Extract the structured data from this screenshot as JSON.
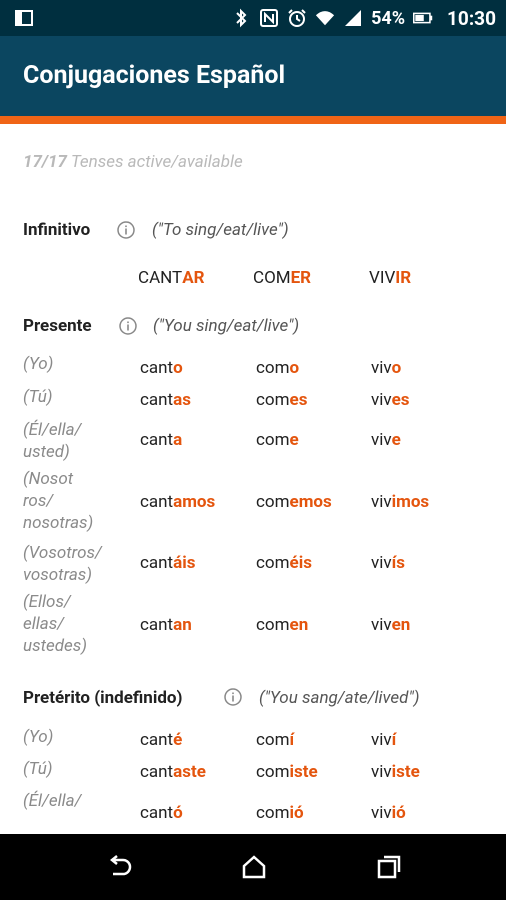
{
  "status_bar": {
    "battery_pct": "54%",
    "time": "10:30"
  },
  "app_bar": {
    "title": "Conjugaciones Español"
  },
  "summary": {
    "count": "17/17",
    "text": "Tenses active/available"
  },
  "infinitivo": {
    "title": "Infinitivo",
    "desc": "(\"To sing/eat/live\")",
    "verbs": [
      {
        "stem": "CANT",
        "end": "AR"
      },
      {
        "stem": "COM",
        "end": "ER"
      },
      {
        "stem": "VIV",
        "end": "IR"
      }
    ]
  },
  "presente": {
    "title": "Presente",
    "desc": "(\"You sing/eat/live\")",
    "rows": [
      {
        "pronoun": [
          "(Yo)"
        ],
        "forms": [
          {
            "stem": "cant",
            "end": "o"
          },
          {
            "stem": "com",
            "end": "o"
          },
          {
            "stem": "viv",
            "end": "o"
          }
        ]
      },
      {
        "pronoun": [
          "(Tú)"
        ],
        "forms": [
          {
            "stem": "cant",
            "end": "as"
          },
          {
            "stem": "com",
            "end": "es"
          },
          {
            "stem": "viv",
            "end": "es"
          }
        ]
      },
      {
        "pronoun": [
          "(Él/ella/",
          "usted)"
        ],
        "forms": [
          {
            "stem": "cant",
            "end": "a"
          },
          {
            "stem": "com",
            "end": "e"
          },
          {
            "stem": "viv",
            "end": "e"
          }
        ]
      },
      {
        "pronoun": [
          "(Nosot",
          "ros/",
          "nosotras)"
        ],
        "forms": [
          {
            "stem": "cant",
            "end": "amos"
          },
          {
            "stem": "com",
            "end": "emos"
          },
          {
            "stem": "viv",
            "end": "imos"
          }
        ]
      },
      {
        "pronoun": [
          "(Vosotros/",
          "vosotras)"
        ],
        "forms": [
          {
            "stem": "cant",
            "end": "áis"
          },
          {
            "stem": "com",
            "end": "éis"
          },
          {
            "stem": "viv",
            "end": "ís"
          }
        ]
      },
      {
        "pronoun": [
          "(Ellos/",
          "ellas/",
          "ustedes)"
        ],
        "forms": [
          {
            "stem": "cant",
            "end": "an"
          },
          {
            "stem": "com",
            "end": "en"
          },
          {
            "stem": "viv",
            "end": "en"
          }
        ]
      }
    ]
  },
  "preterito": {
    "title": "Pretérito (indefinido)",
    "desc": "(\"You sang/ate/lived\")",
    "rows": [
      {
        "pronoun": [
          "(Yo)"
        ],
        "forms": [
          {
            "stem": "cant",
            "end": "é"
          },
          {
            "stem": "com",
            "end": "í"
          },
          {
            "stem": "viv",
            "end": "í"
          }
        ]
      },
      {
        "pronoun": [
          "(Tú)"
        ],
        "forms": [
          {
            "stem": "cant",
            "end": "aste"
          },
          {
            "stem": "com",
            "end": "iste"
          },
          {
            "stem": "viv",
            "end": "iste"
          }
        ]
      },
      {
        "pronoun": [
          "(Él/ella/"
        ],
        "forms": [
          {
            "stem": "cant",
            "end": "ó"
          },
          {
            "stem": "com",
            "end": "ió"
          },
          {
            "stem": "viv",
            "end": "ió"
          }
        ]
      }
    ]
  }
}
